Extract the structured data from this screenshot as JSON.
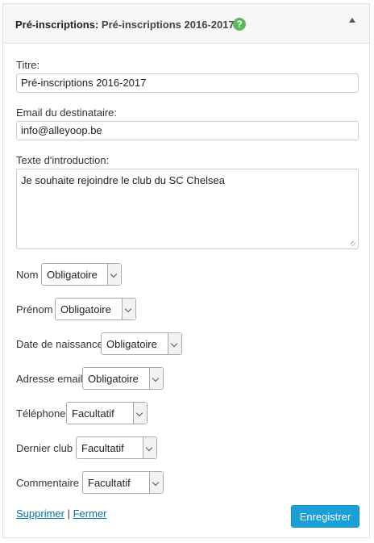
{
  "header": {
    "title_prefix": "Pré-inscriptions:",
    "title_name": "Pré-inscriptions 2016-2017",
    "help_icon": "question-circle-icon",
    "help_glyph": "?",
    "collapse_icon": "caret-up-icon",
    "accent_help": "#5cb85c"
  },
  "form": {
    "title_label": "Titre:",
    "title_value": "Pré-inscriptions 2016-2017",
    "email_label": "Email du destinataire:",
    "email_value": "info@alleyoop.be",
    "intro_label": "Texte d'introduction:",
    "intro_value": "Je souhaite rejoindre le club du SC Chelsea"
  },
  "fields": [
    {
      "label": "Nom",
      "value": "Obligatoire"
    },
    {
      "label": "Prénom",
      "value": "Obligatoire"
    },
    {
      "label": "Date de naissance",
      "value": "Obligatoire"
    },
    {
      "label": "Adresse email",
      "value": "Obligatoire"
    },
    {
      "label": "Téléphone",
      "value": "Facultatif"
    },
    {
      "label": "Dernier club",
      "value": "Facultatif"
    },
    {
      "label": "Commentaire",
      "value": "Facultatif"
    }
  ],
  "footer": {
    "delete_link": "Supprimer",
    "separator": "|",
    "close_link": "Fermer",
    "save_button": "Enregistrer",
    "save_color": "#1a9fd9"
  }
}
